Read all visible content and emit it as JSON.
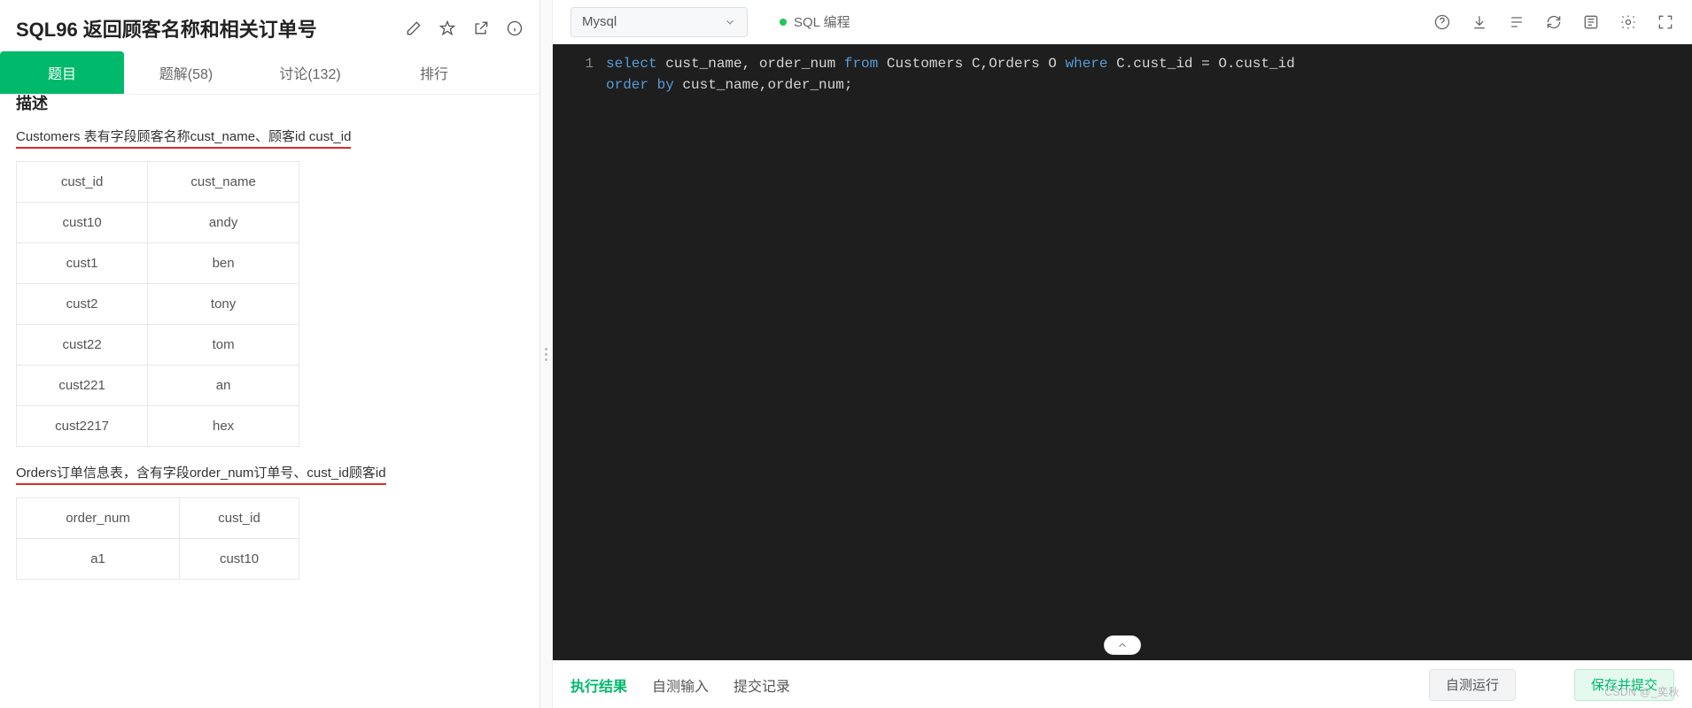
{
  "header": {
    "title": "SQL96  返回顾客名称和相关订单号"
  },
  "tabs": [
    {
      "label": "题目",
      "active": true
    },
    {
      "label": "题解(58)",
      "active": false
    },
    {
      "label": "讨论(132)",
      "active": false
    },
    {
      "label": "排行",
      "active": false
    }
  ],
  "content": {
    "desc_head": "描述",
    "customers_desc": "Customers 表有字段顾客名称cust_name、顾客id cust_id",
    "customers_table": {
      "headers": [
        "cust_id",
        "cust_name"
      ],
      "rows": [
        [
          "cust10",
          "andy"
        ],
        [
          "cust1",
          "ben"
        ],
        [
          "cust2",
          "tony"
        ],
        [
          "cust22",
          "tom"
        ],
        [
          "cust221",
          "an"
        ],
        [
          "cust2217",
          "hex"
        ]
      ]
    },
    "orders_desc": "Orders订单信息表，含有字段order_num订单号、cust_id顾客id",
    "orders_table": {
      "headers": [
        "order_num",
        "cust_id"
      ],
      "rows": [
        [
          "a1",
          "cust10"
        ]
      ]
    }
  },
  "editor": {
    "language": "Mysql",
    "mode": "SQL 编程",
    "line_number": "1",
    "code_tokens": [
      {
        "t": "select",
        "c": "kw"
      },
      {
        "t": " cust_name, order_num ",
        "c": "plain"
      },
      {
        "t": "from",
        "c": "kw"
      },
      {
        "t": " Customers C,Orders O ",
        "c": "plain"
      },
      {
        "t": "where",
        "c": "kw"
      },
      {
        "t": " C.cust_id = O.cust_id\n",
        "c": "plain"
      },
      {
        "t": "order",
        "c": "kw"
      },
      {
        "t": " ",
        "c": "plain"
      },
      {
        "t": "by",
        "c": "kw"
      },
      {
        "t": " cust_name,order_num;",
        "c": "plain"
      }
    ]
  },
  "bottom": {
    "tabs": [
      {
        "label": "执行结果",
        "active": true
      },
      {
        "label": "自测输入",
        "active": false
      },
      {
        "label": "提交记录",
        "active": false
      }
    ],
    "run_label": "自测运行",
    "submit_label": "保存并提交"
  },
  "watermark": "CSDN @_奕秋"
}
